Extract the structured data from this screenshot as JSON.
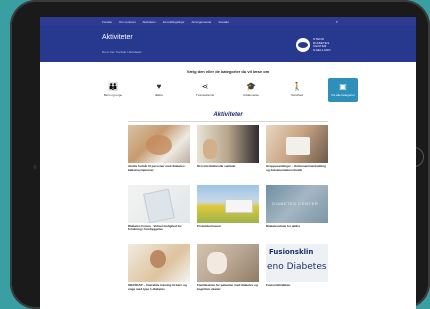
{
  "topnav": {
    "items": [
      "Forside",
      "Om centeret",
      "Aktiviteter",
      "Formidlingslinjer",
      "Arrangementer",
      "Kontakt"
    ],
    "search_icon": "search-icon"
  },
  "banner": {
    "title": "Aktiviteter",
    "breadcrumb": "Du er her: Forside / Aktiviteter",
    "logo_text": [
      "STENO",
      "DIABETES",
      "CENTER",
      "SJÆLLAND"
    ]
  },
  "prompt": "Vælg den eller de kategorier du vil læse om",
  "categories": [
    {
      "label": "Børn og unge",
      "icon": "family-icon"
    },
    {
      "label": "Ældre",
      "icon": "heart-icon"
    },
    {
      "label": "Tværsektoriel",
      "icon": "share-icon"
    },
    {
      "label": "Uddannelse",
      "icon": "graduation-cap-icon"
    },
    {
      "label": "Sundhed",
      "icon": "person-icon"
    },
    {
      "label": "Vis alle kategorier",
      "icon": "briefcase-icon",
      "active": true
    }
  ],
  "section_title": "Aktiviteter",
  "cards": [
    {
      "caption": "Akutte fodsår til personer med diabetes: kalkunsymptomer"
    },
    {
      "caption": "Den interkulturelle samtale"
    },
    {
      "caption": "Gruppesamlinger – Kultursammenkobling og dokumentationsforløb"
    },
    {
      "caption": "Diabetes Forum - Virtuel mulighed for forskning i forebyggelse"
    },
    {
      "caption": "Proteinkuriosum"
    },
    {
      "caption": "Diabetesskole for ældre"
    },
    {
      "caption": "SDASKAP – Interaktiv træning til børn og unge med type 1-diabetes"
    },
    {
      "caption": "Familieskole for patienter med diabetes og kognitive skader"
    },
    {
      "caption": "Fusionsklinikken"
    }
  ],
  "card9_text": {
    "line1": "Fusionsklin",
    "line2": "eno Diabetes Cent"
  }
}
